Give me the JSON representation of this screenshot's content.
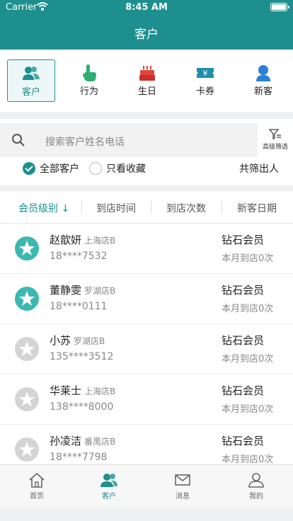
{
  "status": {
    "carrier": "Carrier",
    "time": "8:45 AM"
  },
  "header": {
    "title": "客户"
  },
  "colors": {
    "accent": "#1e8f8f"
  },
  "categories": [
    {
      "label": "客户",
      "icon": "customers-icon",
      "active": true
    },
    {
      "label": "行为",
      "icon": "pointer-hand-icon",
      "active": false
    },
    {
      "label": "生日",
      "icon": "cake-icon",
      "active": false
    },
    {
      "label": "卡券",
      "icon": "coupon-icon",
      "active": false
    },
    {
      "label": "新客",
      "icon": "new-customer-icon",
      "active": false
    }
  ],
  "search": {
    "placeholder": "搜索客户姓名电话",
    "filter_label": "高级筛选"
  },
  "options": {
    "all": "全部客户",
    "favorites": "只看收藏",
    "count_text": "共筛出人"
  },
  "sort": [
    "会员级别 ↓",
    "到店时间",
    "到店次数",
    "新客日期"
  ],
  "customers": [
    {
      "name": "赵歆妍",
      "store": "上海店B",
      "phone": "18****7532",
      "level": "钻石会员",
      "visits": "本月到店0次",
      "avatar": "teal-star"
    },
    {
      "name": "董静雯",
      "store": "罗湖店B",
      "phone": "18****0111",
      "level": "钻石会员",
      "visits": "本月到店0次",
      "avatar": "teal-star"
    },
    {
      "name": "小苏",
      "store": "罗湖店B",
      "phone": "135****3512",
      "level": "钻石会员",
      "visits": "本月到店0次",
      "avatar": "gray-star"
    },
    {
      "name": "华莱士",
      "store": "上海店B",
      "phone": "138****8000",
      "level": "钻石会员",
      "visits": "本月到店0次",
      "avatar": "gray-star"
    },
    {
      "name": "孙凌洁",
      "store": "番禺店B",
      "phone": "18****7798",
      "level": "钻石会员",
      "visits": "本月到店0次",
      "avatar": "gray-star"
    }
  ],
  "tabs": [
    {
      "label": "首页",
      "icon": "home-icon",
      "active": false
    },
    {
      "label": "客户",
      "icon": "customers-icon",
      "active": true
    },
    {
      "label": "消息",
      "icon": "message-icon",
      "active": false
    },
    {
      "label": "我的",
      "icon": "profile-icon",
      "active": false
    }
  ]
}
